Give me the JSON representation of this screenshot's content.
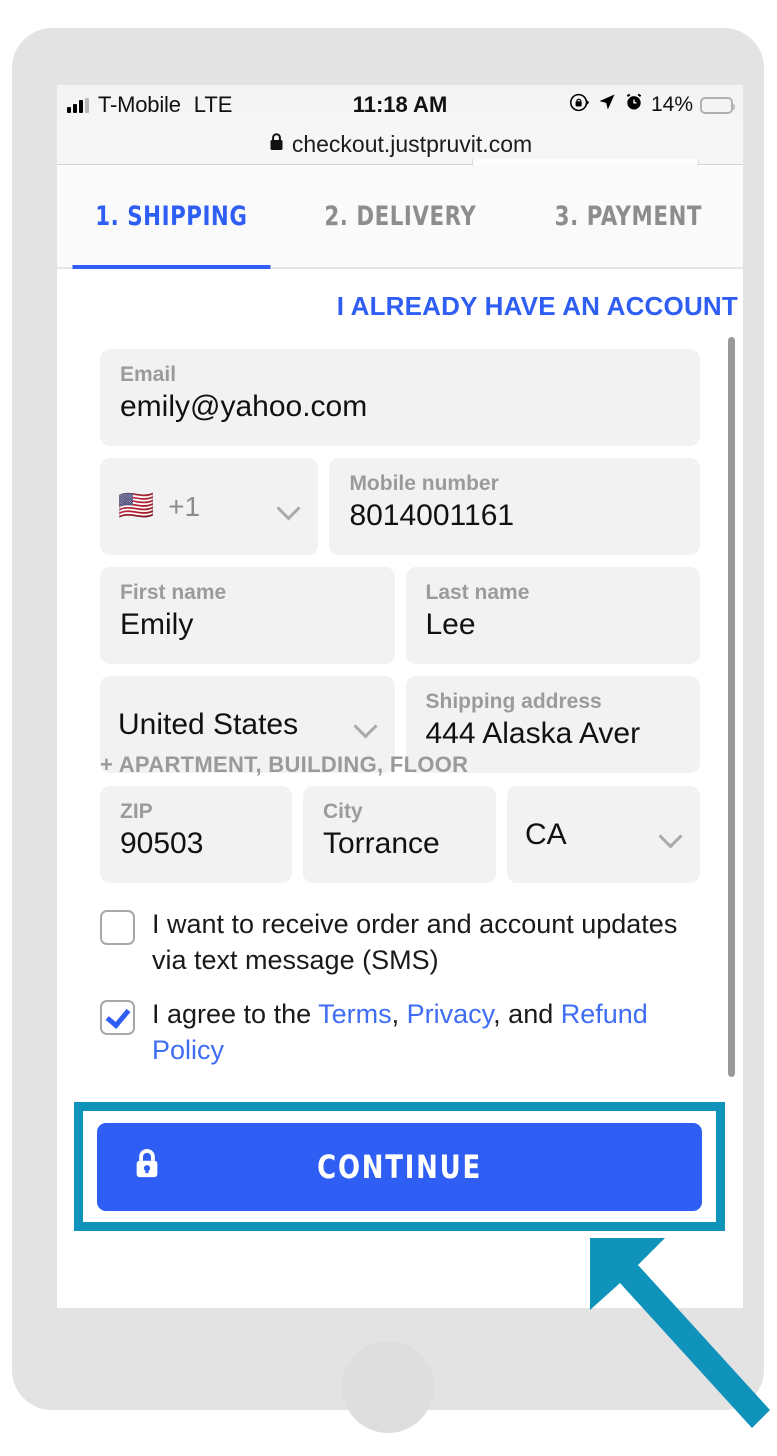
{
  "status_bar": {
    "carrier": "T-Mobile",
    "network": "LTE",
    "time": "11:18 AM",
    "battery_percent": "14%",
    "icons": [
      "signal-bars-icon",
      "rotation-lock-icon",
      "location-arrow-icon",
      "alarm-clock-icon",
      "battery-icon"
    ]
  },
  "browser": {
    "url": "checkout.justpruvit.com",
    "lock_icon": "lock-icon"
  },
  "tabs": [
    {
      "label": "1. SHIPPING",
      "active": true
    },
    {
      "label": "2. DELIVERY",
      "active": false
    },
    {
      "label": "3. PAYMENT",
      "active": false
    }
  ],
  "account_link": "I ALREADY HAVE AN ACCOUNT",
  "form": {
    "email": {
      "label": "Email",
      "value": "emily@yahoo.com"
    },
    "country_code": {
      "flag": "🇺🇸",
      "value": "+1",
      "chevron": "chevron-down-icon"
    },
    "mobile": {
      "label": "Mobile number",
      "value": "8014001161"
    },
    "first_name": {
      "label": "First name",
      "value": "Emily"
    },
    "last_name": {
      "label": "Last name",
      "value": "Lee"
    },
    "country": {
      "value": "United States",
      "chevron": "chevron-down-icon"
    },
    "address": {
      "label": "Shipping address",
      "value": "444 Alaska Aver"
    },
    "apartment_link": "+ APARTMENT, BUILDING, FLOOR",
    "zip": {
      "label": "ZIP",
      "value": "90503"
    },
    "city": {
      "label": "City",
      "value": "Torrance"
    },
    "state": {
      "value": "CA",
      "chevron": "chevron-down-icon"
    }
  },
  "checkboxes": {
    "sms": {
      "checked": false,
      "text": "I want to receive order and account updates via text message (SMS)"
    },
    "terms": {
      "checked": true,
      "prefix": "I agree to the ",
      "terms_link": "Terms",
      "sep1": ", ",
      "privacy_link": "Privacy",
      "sep2": ", and ",
      "refund_link": "Refund Policy"
    }
  },
  "continue_button": {
    "label": "CONTINUE",
    "icon": "lock-icon"
  },
  "colors": {
    "accent_blue": "#2f5ef5",
    "link_blue": "#3f6df5",
    "highlight_teal": "#0f93bb",
    "field_gray": "#f2f2f2",
    "label_gray": "#9b9b9b",
    "battery_yellow": "#f7c02e",
    "phone_body": "#e3e3e3"
  }
}
